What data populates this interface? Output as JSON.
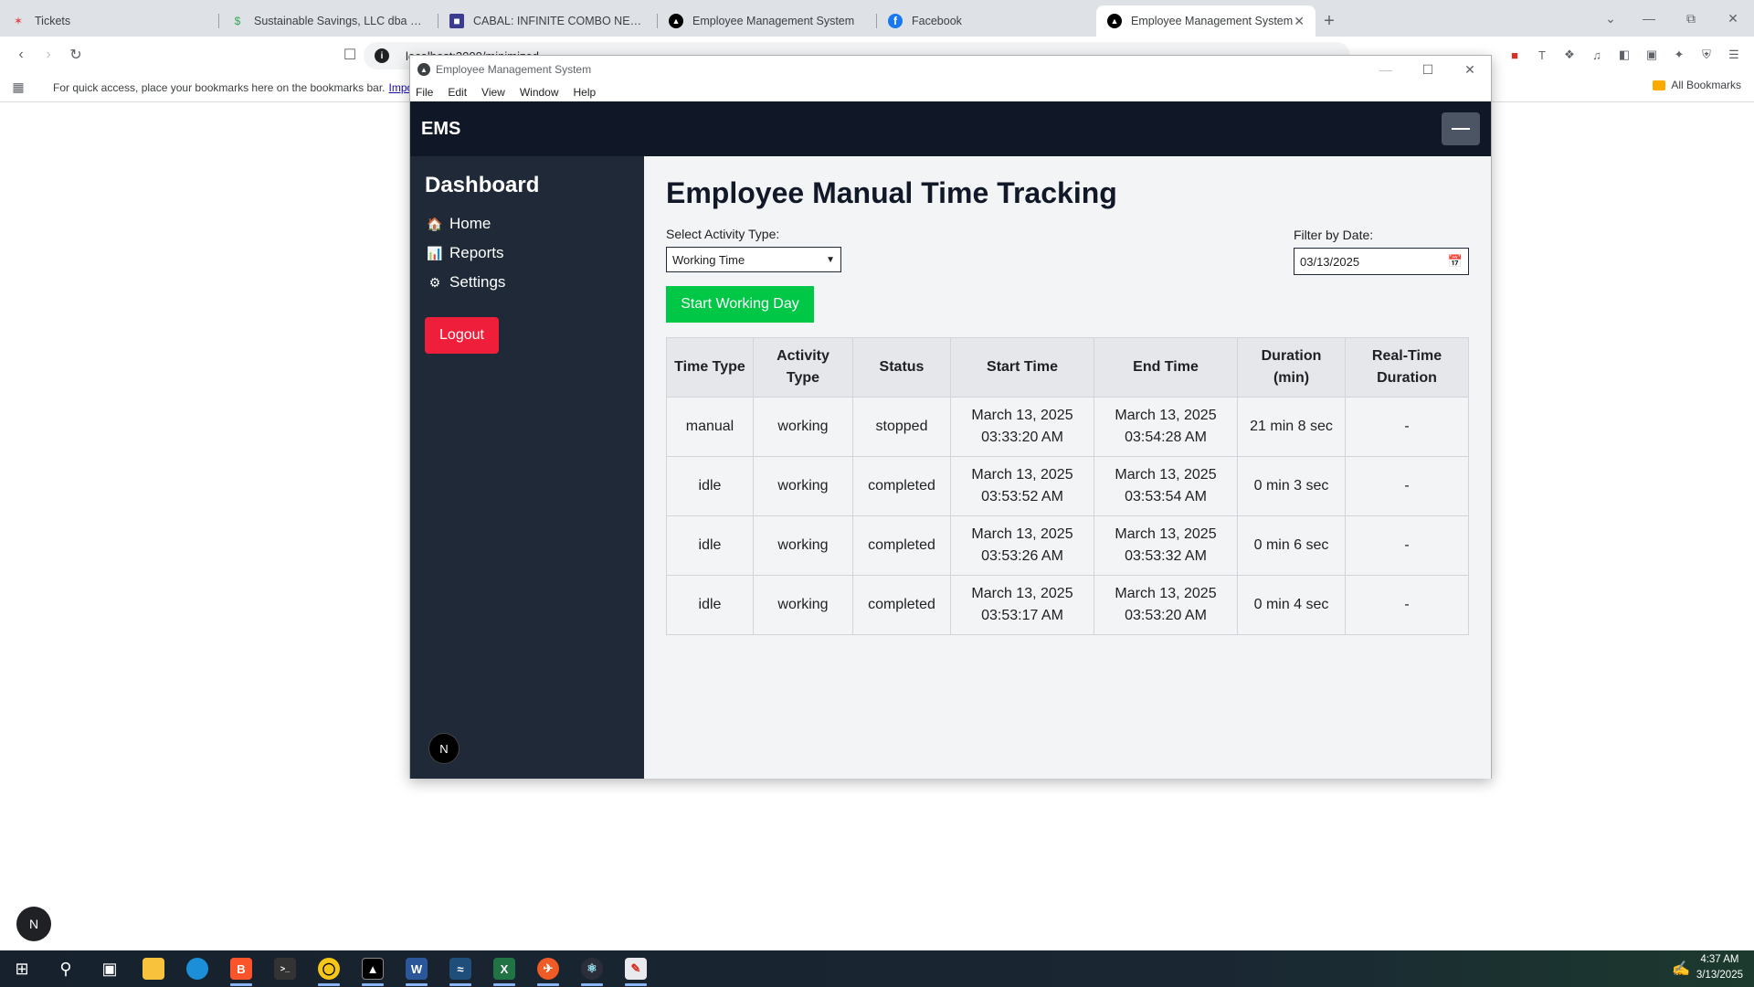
{
  "browser": {
    "tabs": [
      {
        "title": "Tickets",
        "icon": "zendesk-icon",
        "color": "#e34850"
      },
      {
        "title": "Sustainable Savings, LLC dba Sustai",
        "icon": "dollar-icon",
        "color": "#34a853"
      },
      {
        "title": "CABAL: INFINITE COMBO NEWS",
        "icon": "cabal-icon",
        "color": "#3b3b8f"
      },
      {
        "title": "Employee Management System",
        "icon": "app-icon",
        "color": "#000000"
      },
      {
        "title": "Facebook",
        "icon": "facebook-icon",
        "color": "#1877f2"
      },
      {
        "title": "Employee Management System",
        "icon": "app-icon",
        "color": "#000000"
      }
    ],
    "url": "localhost:3000/minimized",
    "bookmarks_text": "For quick access, place your bookmarks here on the bookmarks bar.",
    "bookmarks_link": "Impo",
    "all_bookmarks": "All Bookmarks"
  },
  "app_window": {
    "title": "Employee Management System",
    "menu": [
      "File",
      "Edit",
      "View",
      "Window",
      "Help"
    ]
  },
  "ems": {
    "brand": "EMS",
    "sidebar": {
      "heading": "Dashboard",
      "items": [
        {
          "label": "Home",
          "icon": "home-icon"
        },
        {
          "label": "Reports",
          "icon": "chart-icon"
        },
        {
          "label": "Settings",
          "icon": "gear-icon"
        }
      ],
      "logout": "Logout"
    },
    "main": {
      "title": "Employee Manual Time Tracking",
      "activity_label": "Select Activity Type:",
      "activity_value": "Working Time",
      "date_label": "Filter by Date:",
      "date_value": "03/13/2025",
      "start_button": "Start Working Day",
      "table": {
        "headers": [
          "Time Type",
          "Activity Type",
          "Status",
          "Start Time",
          "End Time",
          "Duration (min)",
          "Real-Time Duration"
        ],
        "rows": [
          {
            "time_type": "manual",
            "activity": "working",
            "status": "stopped",
            "start_date": "March 13, 2025",
            "start_time": "03:33:20 AM",
            "end_date": "March 13, 2025",
            "end_time": "03:54:28 AM",
            "duration": "21 min 8 sec",
            "realtime": "-"
          },
          {
            "time_type": "idle",
            "activity": "working",
            "status": "completed",
            "start_date": "March 13, 2025",
            "start_time": "03:53:52 AM",
            "end_date": "March 13, 2025",
            "end_time": "03:53:54 AM",
            "duration": "0 min 3 sec",
            "realtime": "-"
          },
          {
            "time_type": "idle",
            "activity": "working",
            "status": "completed",
            "start_date": "March 13, 2025",
            "start_time": "03:53:26 AM",
            "end_date": "March 13, 2025",
            "end_time": "03:53:32 AM",
            "duration": "0 min 6 sec",
            "realtime": "-"
          },
          {
            "time_type": "idle",
            "activity": "working",
            "status": "completed",
            "start_date": "March 13, 2025",
            "start_time": "03:53:17 AM",
            "end_date": "March 13, 2025",
            "end_time": "03:53:20 AM",
            "duration": "0 min 4 sec",
            "realtime": "-"
          }
        ]
      }
    },
    "badge": "N"
  },
  "page_badge": "N",
  "taskbar": {
    "time": "4:37 AM",
    "date": "3/13/2025",
    "apps": [
      "windows-start-icon",
      "search-icon",
      "task-view-icon",
      "file-explorer-icon",
      "edge-icon",
      "brave-icon",
      "terminal-icon",
      "chatgpt-icon",
      "app-icon",
      "word-icon",
      "azure-data-studio-icon",
      "excel-icon",
      "postman-icon",
      "electron-icon",
      "paint-icon"
    ]
  },
  "colors": {
    "header_bg": "#101827",
    "sidebar_bg": "#1f2937",
    "logout_bg": "#ef1f3c",
    "start_bg": "#00c846"
  }
}
